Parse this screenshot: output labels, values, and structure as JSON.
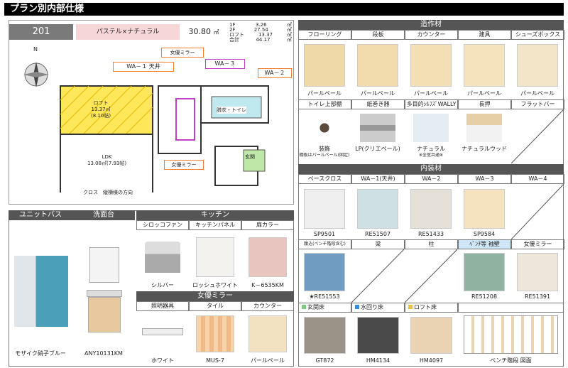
{
  "title": "プラン別内部仕様",
  "plan": {
    "room": "201",
    "style": "パステル×ナチュラル",
    "area_total": "30.80",
    "area_unit": "㎡",
    "floors": [
      {
        "name": "1F",
        "value": "3.26",
        "unit": "㎡"
      },
      {
        "name": "2F",
        "value": "27.54",
        "unit": "㎡"
      },
      {
        "name": "ロフト",
        "value": "13.37",
        "unit": "㎡"
      },
      {
        "name": "合計",
        "value": "44.17",
        "unit": "㎡"
      }
    ],
    "compass": "N",
    "callouts": {
      "wa1": "WA－１ 天井",
      "mirror_top": "女優ミラー",
      "wa3": "WA－３",
      "wa2": "WA－２",
      "mirror_bottom": "女優ミラー"
    },
    "rooms": {
      "loft": "ロフト",
      "loft_area": "13.37㎡",
      "loft_jo": "(8.10帖)",
      "ldk": "LDK",
      "ldk_area": "13.08㎡(7.93帖)",
      "bath": "脱衣・トイレ",
      "genkan": "玄関"
    },
    "cross_direction": "クロス　縦横様の方向"
  },
  "zosaku": {
    "header": "造作材",
    "row1": [
      {
        "label": "フローリング",
        "caption": "パールペール",
        "color": "#f0d9a8"
      },
      {
        "label": "段板",
        "caption": "パールペール",
        "color": "#f2dcae"
      },
      {
        "label": "カウンター",
        "caption": "パールペール",
        "color": "#f3dfb3"
      },
      {
        "label": "建具",
        "caption": "パールペール",
        "color": "#f4e3bd"
      },
      {
        "label": "シューズボックス",
        "caption": "パールペール",
        "color": "#f3e6c8"
      }
    ],
    "row2": [
      {
        "label": "トイレ上部棚",
        "caption": "装飾",
        "sub": "棚板はパールペール(固定)"
      },
      {
        "label": "紙巻き器",
        "caption": "LP(クリエペール)"
      },
      {
        "label": "多目的ｼﾙﾌｽﾞWALLY",
        "caption": "ナチュラル",
        "sub": "※全室共通※"
      },
      {
        "label": "長押",
        "caption": "ナチュラルウッド"
      },
      {
        "label": "フラットバー",
        "caption": ""
      }
    ]
  },
  "naiso": {
    "header": "内装材",
    "row1": [
      {
        "label": "ベースクロス",
        "caption": "SP9501",
        "color": "#efefef"
      },
      {
        "label": "WA－1(天井)",
        "caption": "RE51507",
        "color": "#cfe0e4"
      },
      {
        "label": "WA－2",
        "caption": "RE51433",
        "color": "#e6e1d8"
      },
      {
        "label": "WA－3",
        "caption": "SP9584",
        "color": "#f5e3bf"
      },
      {
        "label": "WA－4",
        "caption": "",
        "color": ""
      }
    ],
    "row2": [
      {
        "label": "腰込(ベンチ階段含む)",
        "caption": "★RE51553",
        "color": "#6f9cc0"
      },
      {
        "label": "梁",
        "caption": "",
        "color": ""
      },
      {
        "label": "柱",
        "caption": "",
        "color": ""
      },
      {
        "label": "ﾍﾞﾝﾁ等 袖壁",
        "caption": "RE51208",
        "color": "#8fb3a0"
      },
      {
        "label": "女優ミラー",
        "caption": "RE51391",
        "color": "#ede6da"
      }
    ],
    "row3": [
      {
        "label": "玄関床",
        "caption": "GT872",
        "color": "#9a9388",
        "dot": "#7fc97f"
      },
      {
        "label": "水回り床",
        "caption": "HM4134",
        "color": "#4a4a4a",
        "dot": "#3b8ed8"
      },
      {
        "label": "ロフト床",
        "caption": "HM4097",
        "color": "#e9d3b3",
        "dot": "#e8c23b"
      },
      {
        "label": "",
        "caption": "ベンチ階段 図面",
        "color": ""
      }
    ]
  },
  "unitbath": {
    "header": "ユニットバス",
    "caption": "モザイク硝子ブルー"
  },
  "senmen": {
    "header": "洗面台",
    "caption": "ANY10131KM"
  },
  "kitchen": {
    "header": "キッチン",
    "items": [
      {
        "label": "シロッコファン",
        "caption": "シルバー"
      },
      {
        "label": "キッチンパネル",
        "caption": "ロッシュホワイト",
        "color": "#f4f2ee"
      },
      {
        "label": "扉カラー",
        "caption": "K－6535KM",
        "color": "#e9c5bf"
      }
    ]
  },
  "joyu": {
    "header": "女優ミラー",
    "items": [
      {
        "label": "照明器具",
        "caption": "ホワイト"
      },
      {
        "label": "タイル",
        "caption": "MUS-7",
        "color": "#f0c79b"
      },
      {
        "label": "カウンター",
        "caption": "パールペール",
        "color": "#f3e2c2"
      }
    ]
  }
}
